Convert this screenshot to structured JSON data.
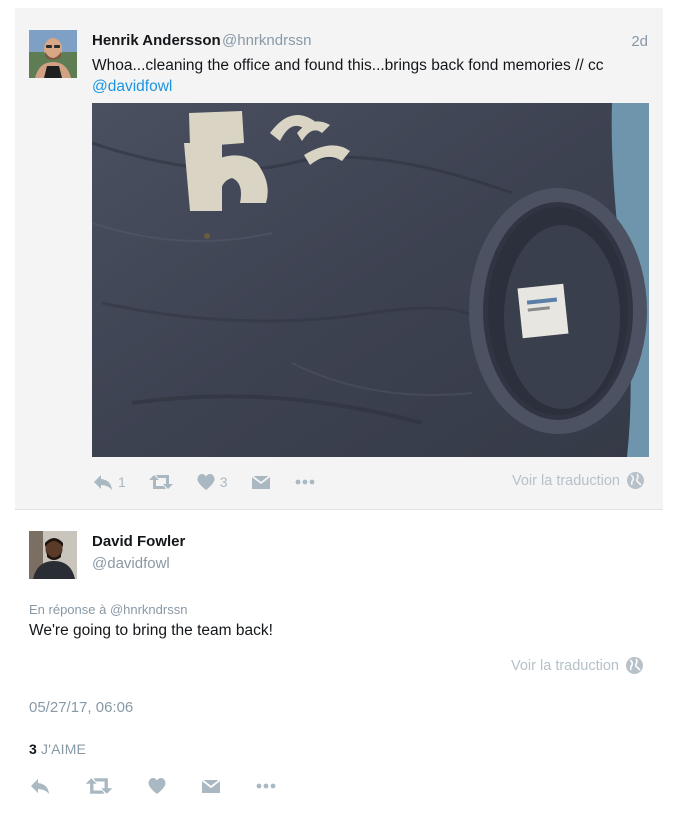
{
  "parent_tweet": {
    "author_name": "Henrik Andersson",
    "author_handle": "@hnrkndrssn",
    "timestamp": "2d",
    "text": "Whoa...cleaning the office and found this...brings back fond memories // cc ",
    "mention": "@davidfowl",
    "media_icon": "tshirt-photo",
    "actions": {
      "reply_count": "1",
      "like_count": "3"
    },
    "translate_label": "Voir la traduction"
  },
  "main_tweet": {
    "author_name": "David Fowler",
    "author_handle": "@davidfowl",
    "reply_to": "En réponse à @hnrkndrssn",
    "text": "We're going to bring the team back!",
    "translate_label": "Voir la traduction",
    "date": "05/27/17, 06:06",
    "likes_count": "3",
    "likes_label": "J'AIME"
  },
  "colors": {
    "accent": "#1b95e0",
    "muted": "#8899a6",
    "icon": "#aab8c2",
    "card_bg": "#f4f4f5"
  }
}
